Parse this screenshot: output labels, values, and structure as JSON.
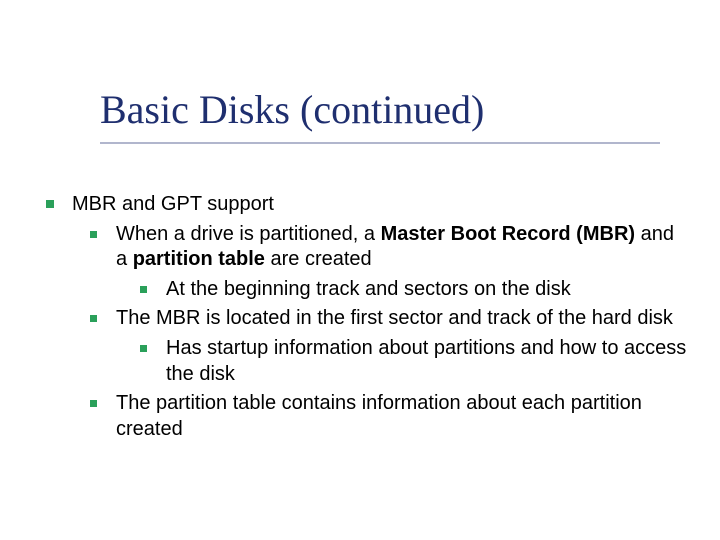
{
  "title": "Basic Disks (continued)",
  "body": {
    "l1": "MBR and GPT support",
    "l2a_pre": "When a drive is partitioned, a ",
    "l2a_b1": "Master Boot Record (MBR)",
    "l2a_mid": " and a ",
    "l2a_b2": "partition table",
    "l2a_post": " are created",
    "l3a": "At the beginning track and sectors on the disk",
    "l2b": "The MBR is located in the first sector and track of the hard disk",
    "l3b": "Has startup information about partitions and how to access the disk",
    "l2c": "The partition table contains information about each partition created"
  },
  "colors": {
    "title": "#1f2f6f",
    "bullet": "#2aa05a"
  }
}
